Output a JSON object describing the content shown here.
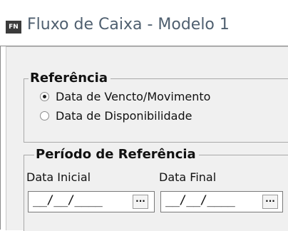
{
  "window": {
    "app_icon_text": "FN",
    "title": "Fluxo de Caixa - Modelo 1"
  },
  "referencia": {
    "title": "Referência",
    "options": [
      {
        "label": "Data de Vencto/Movimento",
        "checked": true
      },
      {
        "label": "Data de Disponibilidade",
        "checked": false
      }
    ]
  },
  "periodo": {
    "title": "Período de Referência",
    "data_inicial": {
      "label": "Data Inicial",
      "value": "__/__/____",
      "button_label": "···"
    },
    "data_final": {
      "label": "Data Final",
      "value": "__/__/____",
      "button_label": "···"
    }
  }
}
